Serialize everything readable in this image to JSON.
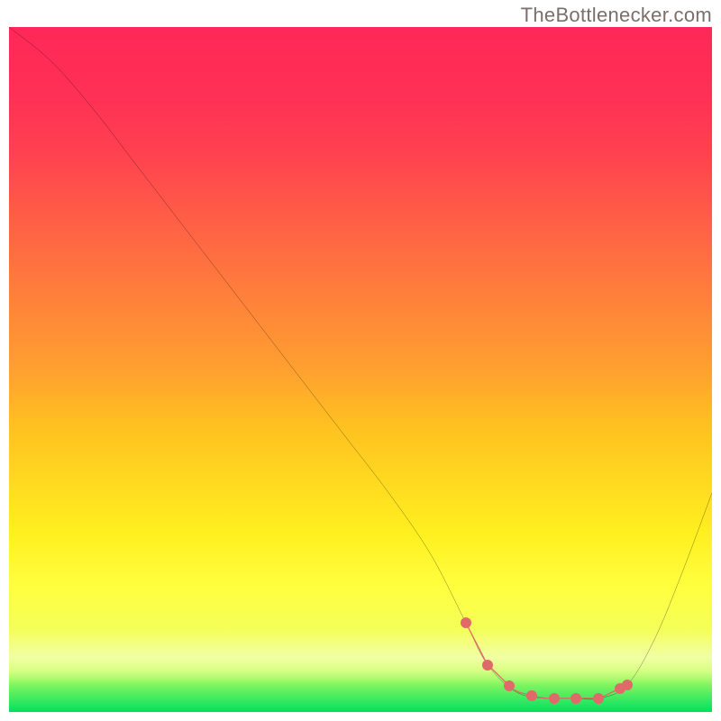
{
  "watermark": "TheBottlenecker.com",
  "chart_data": {
    "type": "line",
    "title": "",
    "xlabel": "",
    "ylabel": "",
    "xlim": [
      0,
      100
    ],
    "ylim": [
      0,
      100
    ],
    "series": [
      {
        "name": "curve",
        "x": [
          0,
          6,
          12,
          18,
          24,
          30,
          36,
          42,
          48,
          54,
          60,
          65,
          68,
          72,
          76,
          80,
          84,
          88,
          92,
          96,
          100
        ],
        "values": [
          100,
          95,
          88,
          80,
          72,
          64,
          56,
          48,
          40,
          32,
          23,
          13,
          7,
          3,
          2,
          2,
          2,
          4,
          11,
          21,
          32
        ]
      }
    ],
    "flat_region_x": [
      65,
      88
    ],
    "flat_y": 2,
    "dot_xs": [
      65.0,
      68.1,
      71.2,
      74.4,
      77.5,
      80.6,
      83.8,
      86.9,
      88.0
    ],
    "colors": {
      "curve": "#000000",
      "dots": "#e06a6a",
      "top": "#ff2858",
      "bottom": "#00e060"
    }
  }
}
